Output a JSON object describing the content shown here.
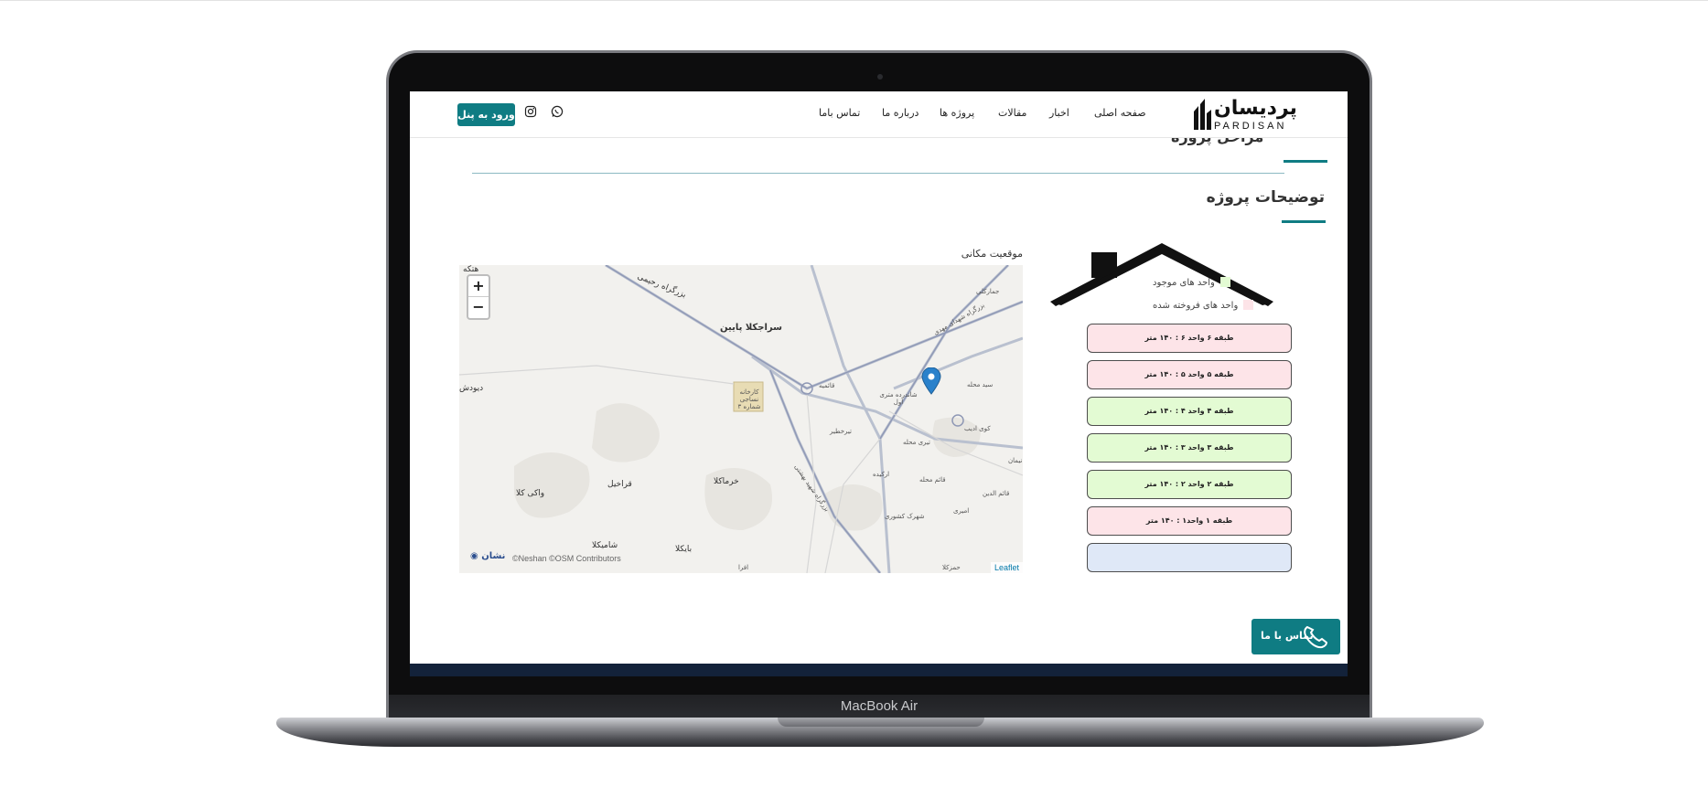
{
  "device": {
    "brand": "MacBook Air"
  },
  "header": {
    "logo": {
      "text": "پردیسان",
      "sub": "PARDISAN"
    },
    "nav": [
      "صفحه اصلی",
      "اخبار",
      "مقالات",
      "پروژه ها",
      "درباره ما",
      "تماس باما"
    ],
    "panel_button": "ورود به پنل",
    "social_icons": [
      "instagram-icon",
      "whatsapp-icon"
    ]
  },
  "page": {
    "prev_section_title": "مراحل پروژه",
    "section_title": "توضیحات پروژه"
  },
  "legend": {
    "available": {
      "label": "واحد های موجود",
      "color": "#e3fbd3"
    },
    "sold": {
      "label": "واحد های فروخته شده",
      "color": "#fde4e8"
    }
  },
  "units": [
    {
      "label": "طبقه ۶ واحد ۶ : ۱۴۰ متر",
      "status": "sold"
    },
    {
      "label": "طبقه ۵ واحد ۵ : ۱۴۰ متر",
      "status": "sold"
    },
    {
      "label": "طبقه ۴ واحد ۴ : ۱۴۰ متر",
      "status": "available"
    },
    {
      "label": "طبقه ۳ واحد ۳ : ۱۴۰ متر",
      "status": "available"
    },
    {
      "label": "طبقه ۲ واحد ۲ : ۱۴۰ متر",
      "status": "available"
    },
    {
      "label": "طبقه ۱ واحد۱ : ۱۴۰ متر",
      "status": "sold"
    },
    {
      "label": "",
      "status": "ground"
    }
  ],
  "map": {
    "label": "موقعیت مکانی",
    "zoom_in": "+",
    "zoom_out": "−",
    "attribution": "©Neshan ©OSM Contributors",
    "neshan_logo": "نشان",
    "leaflet": "Leaflet",
    "places": {
      "hetkeh": "هتکه",
      "seraj_paein": "سراجکلا پایین",
      "road_top": "بزرگراه رحیمی",
      "jamarkola": "جمارکلی",
      "road_right": "بزرگراه شهدای مهدی",
      "ghaemiyeh": "قائمیه",
      "karkhaneh": "کارخانه نساجی شماره ۳",
      "seyed_mahaleh": "سید محله",
      "shahrak": "شاندرده متری اول",
      "divdash": "دیودش",
      "tirkhatir": "تیرخطیر",
      "kuy_adib": "کوی ادیب",
      "nimman": "نیمان",
      "tirri": "تیری محله",
      "arkideh": "ارکیده",
      "ghaem": "قائم محله",
      "ghaem_edin": "قائم الدین",
      "kherakola": "خرماکلا",
      "gharakhil": "قراخیل",
      "vaki": "واکی کلا",
      "road_diag": "بزرگراه شهید بهشتی",
      "amiri": "امیری",
      "keshavarzi": "شهرک کشوری",
      "shamikola": "شامیکلا",
      "baykola": "بایکلا",
      "afra": "افرا",
      "hamdkola": "حمزکلا"
    }
  },
  "contact_button": "تماس با ما"
}
